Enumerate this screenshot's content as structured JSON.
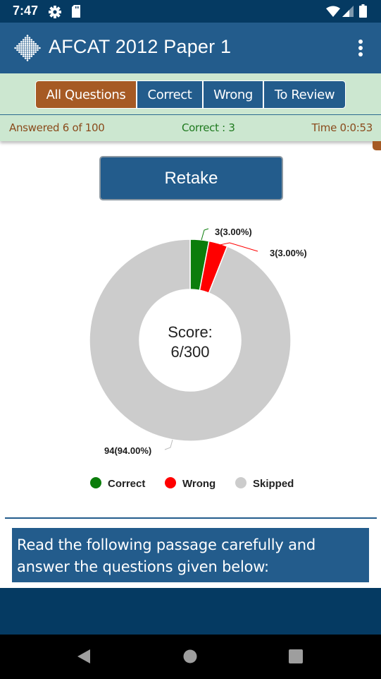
{
  "status_bar": {
    "time": "7:47",
    "left_icons": [
      "gear-icon",
      "sd-card-icon"
    ],
    "right_icons": [
      "wifi-icon",
      "cellular-signal-icon",
      "battery-icon"
    ]
  },
  "app_bar": {
    "logo_icon": "dotted-diamond-logo-icon",
    "title": "AFCAT 2012 Paper 1",
    "menu_icon": "more-vert-icon"
  },
  "filter": {
    "tabs": [
      {
        "label": "All Questions",
        "active": true
      },
      {
        "label": "Correct",
        "active": false
      },
      {
        "label": "Wrong",
        "active": false
      },
      {
        "label": "To Review",
        "active": false
      }
    ],
    "answered": "Answered 6 of 100",
    "correct": "Correct : 3",
    "time": "Time 0:0:53"
  },
  "retake_label": "Retake",
  "chart_data": {
    "type": "pie",
    "variant": "donut",
    "center_label_line1": "Score:",
    "center_label_line2": "6/300",
    "categories": [
      "Correct",
      "Wrong",
      "Skipped"
    ],
    "values": [
      3,
      3,
      94
    ],
    "percentages": [
      3.0,
      3.0,
      94.0
    ],
    "data_labels": [
      "3(3.00%)",
      "3(3.00%)",
      "94(94.00%)"
    ],
    "colors": [
      "#0b7d0b",
      "#ff0000",
      "#cccccc"
    ],
    "legend": [
      "Correct",
      "Wrong",
      "Skipped"
    ],
    "legend_position": "bottom",
    "start_angle": "12 o'clock, clockwise"
  },
  "passage": {
    "text": "Read the following passage carefully and answer the questions given below:"
  },
  "nav_bar": {
    "buttons": [
      "back-icon",
      "home-icon",
      "recents-icon"
    ]
  }
}
